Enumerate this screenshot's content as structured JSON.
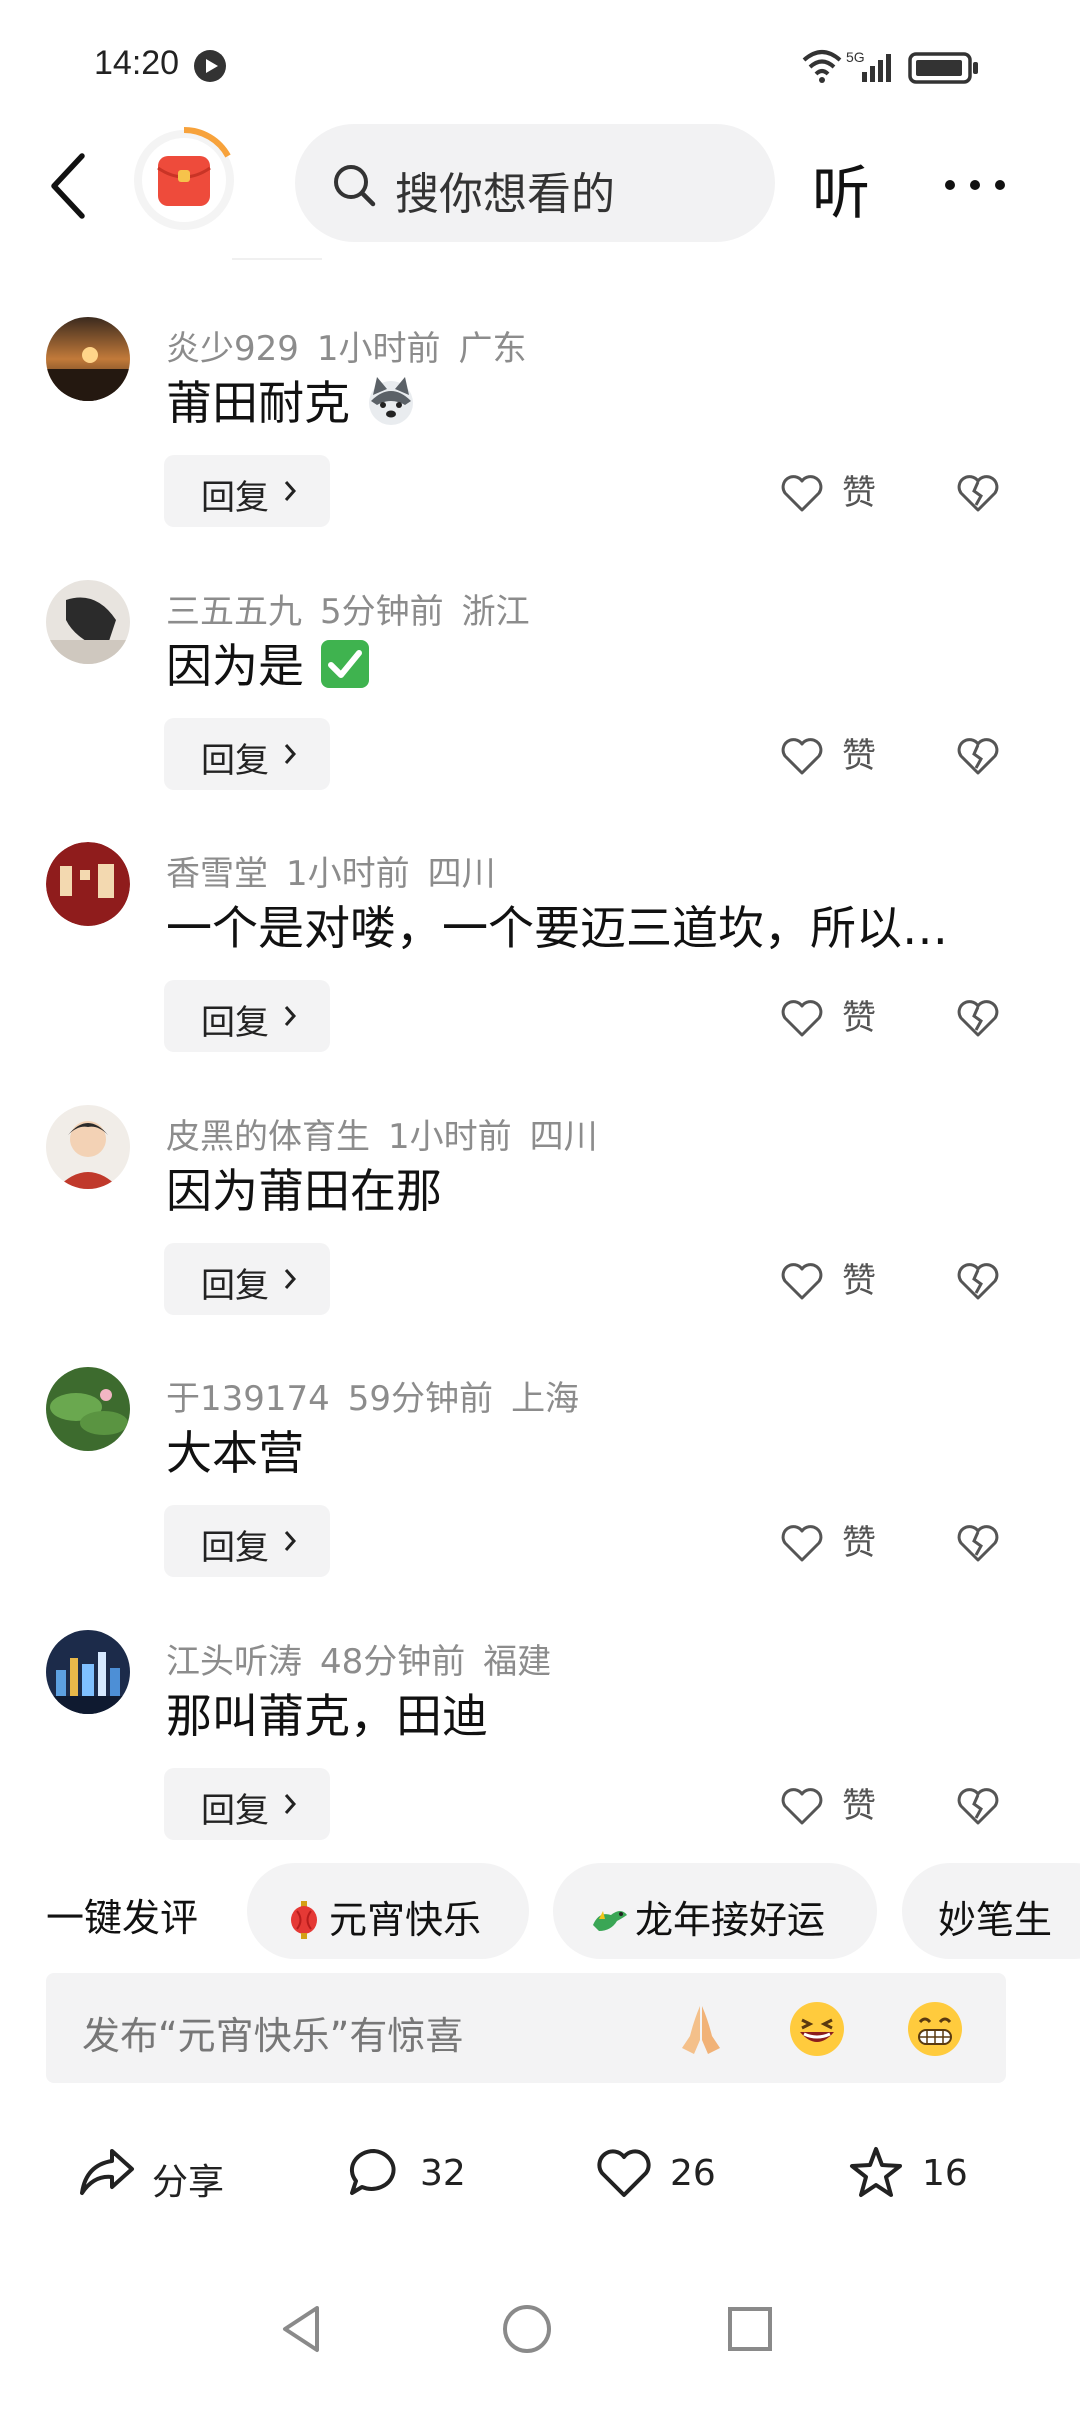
{
  "status_bar": {
    "time": "14:20",
    "network": "5G"
  },
  "header": {
    "search_placeholder": "搜你想看的",
    "listen_label": "听"
  },
  "comments": [
    {
      "user": "炎少929",
      "time": "1小时前",
      "location": "广东",
      "text": "莆田耐克",
      "emoji": "husky-emoji"
    },
    {
      "user": "三五五九",
      "time": "5分钟前",
      "location": "浙江",
      "text": "因为是",
      "emoji": "check-mark-emoji"
    },
    {
      "user": "香雪堂",
      "time": "1小时前",
      "location": "四川",
      "text": "一个是对喽，一个要迈三道坎，所以…",
      "emoji": ""
    },
    {
      "user": "皮黑的体育生",
      "time": "1小时前",
      "location": "四川",
      "text": "因为莆田在那",
      "emoji": ""
    },
    {
      "user": "于139174",
      "time": "59分钟前",
      "location": "上海",
      "text": "大本营",
      "emoji": ""
    },
    {
      "user": "江头听涛",
      "time": "48分钟前",
      "location": "福建",
      "text": "那叫莆克，田迪",
      "emoji": ""
    }
  ],
  "comment_actions": {
    "reply_label": "回复",
    "like_label": "赞"
  },
  "quick_comments": {
    "title": "一键发评",
    "chips": [
      {
        "label": "元宵快乐",
        "icon": "lantern-emoji"
      },
      {
        "label": "龙年接好运",
        "icon": "dragon-emoji"
      },
      {
        "label": "妙笔生",
        "icon": ""
      }
    ]
  },
  "comment_input": {
    "placeholder": "发布“元宵快乐”有惊喜",
    "emojis": [
      "praying-hands-emoji",
      "laughing-emoji",
      "grinning-emoji"
    ]
  },
  "action_bar": {
    "share_label": "分享",
    "comment_count": "32",
    "like_count": "26",
    "favorite_count": "16"
  },
  "colors": {
    "meta_gray": "#8c8c8c",
    "chip_bg": "#f3f3f4",
    "accent_red": "#ee4b3b"
  }
}
